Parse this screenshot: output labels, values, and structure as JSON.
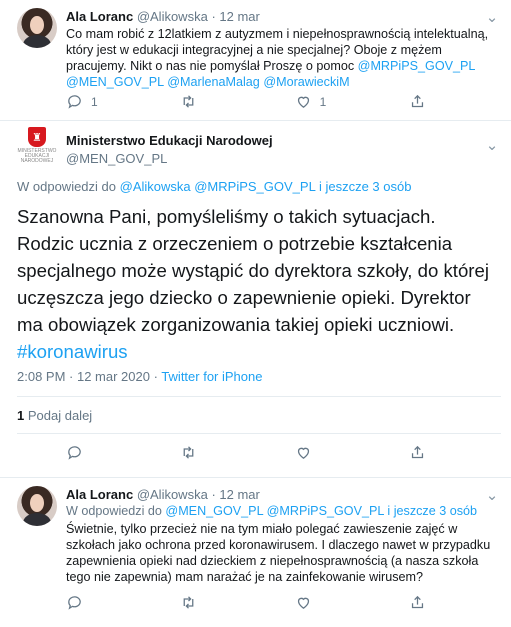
{
  "tweet1": {
    "name": "Ala Loranc",
    "handle": "@Alikowska",
    "dot": "·",
    "date": "12 mar",
    "text_lines": [
      "Co mam robić z 12latkiem z autyzmem i niepełnosprawnością intelektualną,",
      "który jest w edukacji integracyjnej a nie specjalnej? Oboje z mężem",
      "pracujemy. Nikt o nas nie pomyślał Proszę o pomoc"
    ],
    "mentions_line1_end": "@MRPiPS_GOV_PL",
    "mentions_line2": [
      "@MEN_GOV_PL",
      "@MarlenaMalag",
      "@MorawieckiM"
    ],
    "reply_count": "1",
    "retweet_count": "",
    "like_count": "1"
  },
  "main": {
    "org_name": "Ministerstwo Edukacji Narodowej",
    "handle": "@MEN_GOV_PL",
    "logo_lines": [
      "MINISTERSTWO",
      "EDUKACJI",
      "NARODOWEJ"
    ],
    "reply_to_prefix": "W odpowiedzi do",
    "reply_to_users": "@Alikowska @MRPiPS_GOV_PL",
    "reply_to_more": "i jeszcze 3 osób",
    "text": "Szanowna Pani, pomyśleliśmy o takich sytuacjach. Rodzic ucznia z orzeczeniem o potrzebie kształcenia specjalnego może wystąpić do dyrektora szkoły, do której uczęszcza jego dziecko o zapewnienie opieki. Dyrektor ma obowiązek zorganizowania takiej opieki uczniowi.",
    "hashtag": "#koronawirus",
    "time": "2:08 PM",
    "date": "12 mar 2020",
    "source": "Twitter for iPhone",
    "retweet_count": "1",
    "retweet_label": "Podaj dalej"
  },
  "tweet3": {
    "name": "Ala Loranc",
    "handle": "@Alikowska",
    "dot": "·",
    "date": "12 mar",
    "reply_to_prefix": "W odpowiedzi do",
    "reply_to_users": "@MEN_GOV_PL @MRPiPS_GOV_PL",
    "reply_to_more": "i jeszcze 3 osób",
    "text_lines": [
      "Świetnie, tylko przecież nie na tym miało polegać zawieszenie zajęć w",
      "szkołach jako ochrona przed koronawirusem. I dlaczego nawet w przypadku",
      "zapewnienia opieki nad dzieckiem z niepełnosprawnością  (a nasza szkoła",
      "tego nie zapewnia) mam narażać je na zainfekowanie wirusem?"
    ]
  },
  "colors": {
    "link": "#1da1f2",
    "muted": "#657786",
    "border": "#e6ecf0"
  }
}
